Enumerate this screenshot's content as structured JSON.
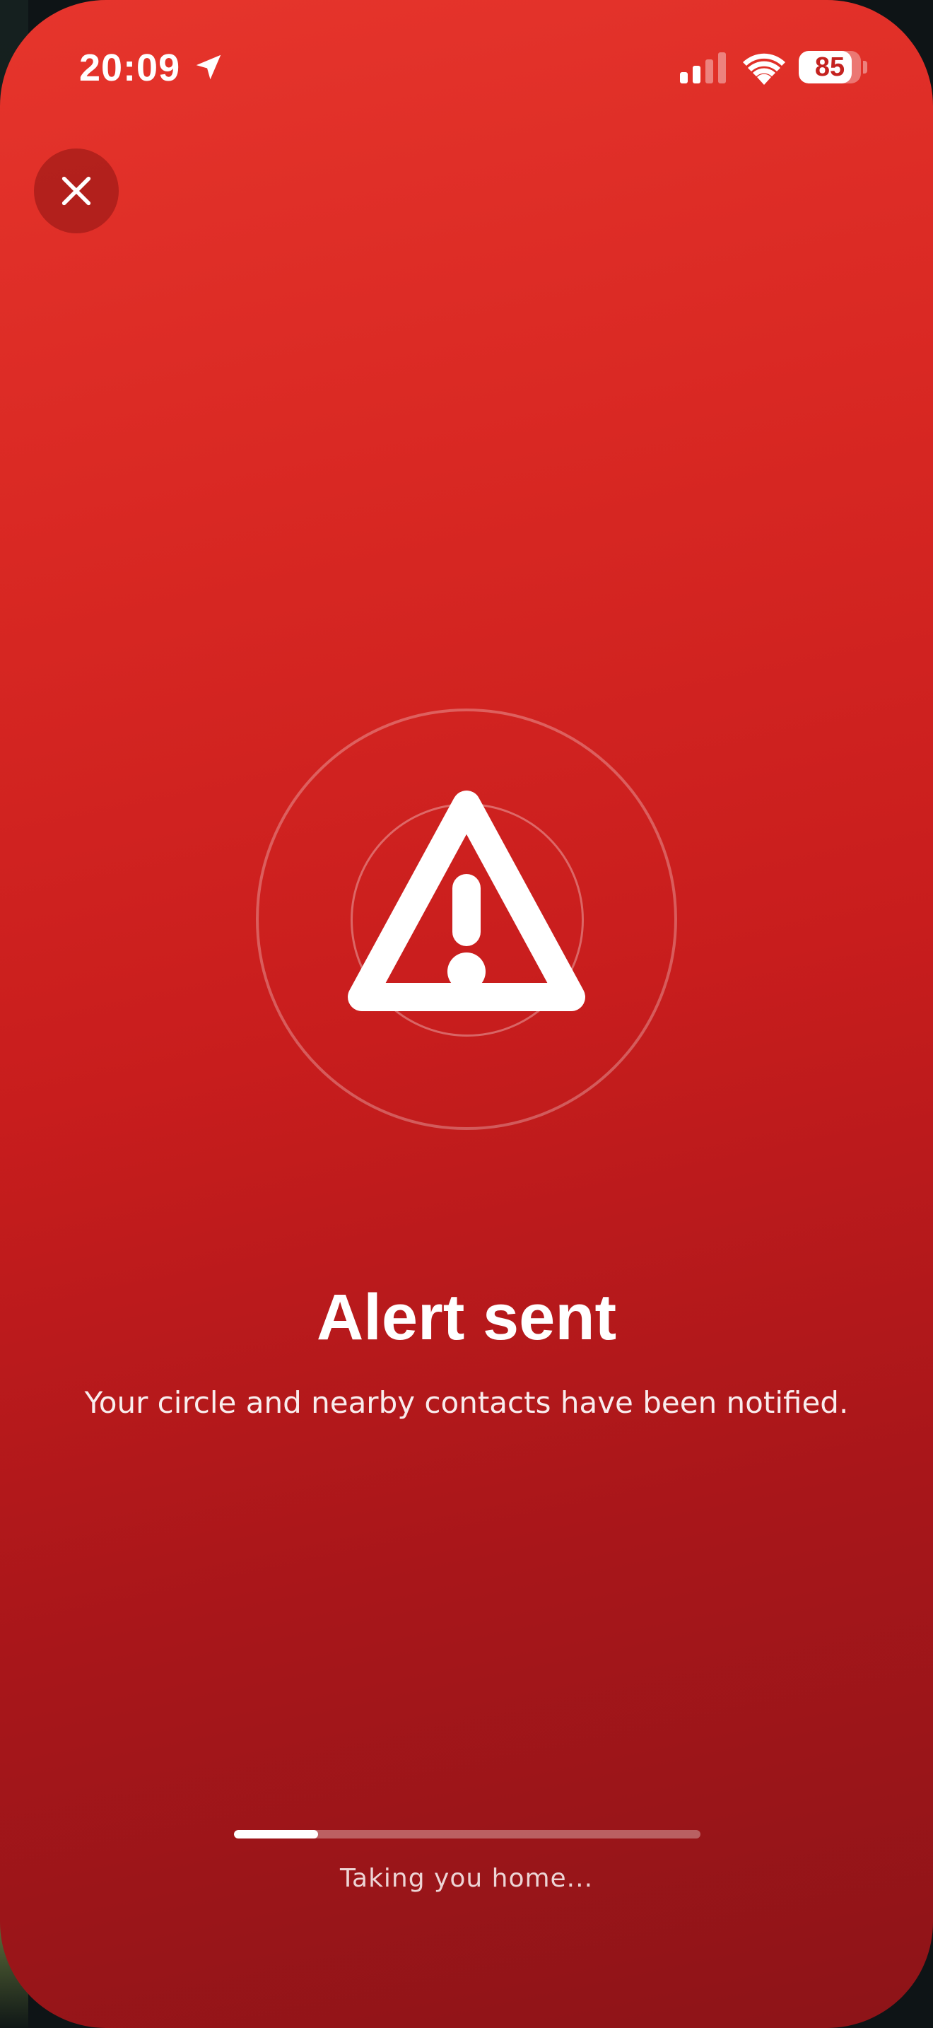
{
  "status_bar": {
    "time": "20:09",
    "battery_level": "85",
    "icons": [
      "location-arrow-icon",
      "cellular-signal-icon",
      "wifi-icon",
      "battery-icon"
    ]
  },
  "close_button": {
    "icon": "close-icon"
  },
  "alert": {
    "icon": "warning-triangle-icon",
    "title": "Alert sent",
    "message": "Your circle and nearby contacts have been notified."
  },
  "progress": {
    "fraction": 0.18,
    "label": "Taking you home..."
  },
  "colors": {
    "background_top": "#e6352c",
    "background_bottom": "#8d1418",
    "foreground": "#ffffff"
  }
}
